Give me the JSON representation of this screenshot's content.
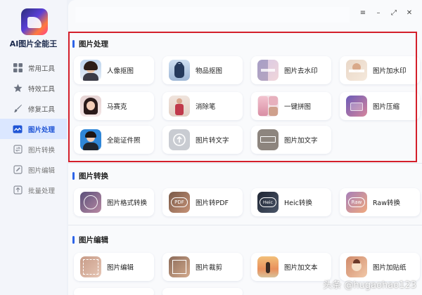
{
  "app": {
    "name": "AI图片全能王"
  },
  "nav": [
    {
      "label": "常用工具",
      "icon": "grid-icon"
    },
    {
      "label": "特效工具",
      "icon": "star-icon"
    },
    {
      "label": "修复工具",
      "icon": "brush-icon"
    },
    {
      "label": "图片处理",
      "icon": "image-wave-icon",
      "active": true
    },
    {
      "label": "图片转换",
      "icon": "convert-icon"
    },
    {
      "label": "图片编辑",
      "icon": "edit-icon"
    },
    {
      "label": "批量处理",
      "icon": "batch-icon"
    }
  ],
  "window_controls": {
    "menu": "≡",
    "minimize": "–",
    "maximize": "⤢",
    "close": "✕"
  },
  "sections": [
    {
      "title": "图片处理",
      "cards": [
        {
          "label": "人像抠图",
          "thumb": "portrait-thumb"
        },
        {
          "label": "物品抠图",
          "thumb": "backpack-thumb"
        },
        {
          "label": "图片去水印",
          "thumb": "remove-watermark-thumb"
        },
        {
          "label": "图片加水印",
          "thumb": "add-watermark-thumb"
        },
        {
          "label": "马赛克",
          "thumb": "mosaic-thumb"
        },
        {
          "label": "消除笔",
          "thumb": "eraser-thumb"
        },
        {
          "label": "一键拼图",
          "thumb": "collage-thumb"
        },
        {
          "label": "图片压缩",
          "thumb": "compress-thumb"
        },
        {
          "label": "全能证件照",
          "thumb": "id-photo-thumb"
        },
        {
          "label": "图片转文字",
          "thumb": "upload-thumb"
        },
        {
          "label": "图片加文字",
          "thumb": "add-text-thumb"
        }
      ]
    },
    {
      "title": "图片转换",
      "cards": [
        {
          "label": "图片格式转换",
          "thumb": "format-thumb"
        },
        {
          "label": "图片转PDF",
          "thumb": "pdf-thumb",
          "badge": "PDF"
        },
        {
          "label": "Heic转换",
          "thumb": "heic-thumb",
          "badge": "Heic"
        },
        {
          "label": "Raw转换",
          "thumb": "raw-thumb",
          "badge": "Raw"
        }
      ]
    },
    {
      "title": "图片编辑",
      "cards": [
        {
          "label": "图片编辑",
          "thumb": "edit-thumb"
        },
        {
          "label": "图片裁剪",
          "thumb": "crop-thumb"
        },
        {
          "label": "图片加文本",
          "thumb": "beach-thumb"
        },
        {
          "label": "图片加贴纸",
          "thumb": "sticker-thumb"
        }
      ]
    }
  ],
  "watermark": "头条 @hugaohao123",
  "colors": {
    "accent": "#2d64e8",
    "highlight_border": "#d41f2a",
    "active_nav_bg": "#dbe7ff"
  }
}
